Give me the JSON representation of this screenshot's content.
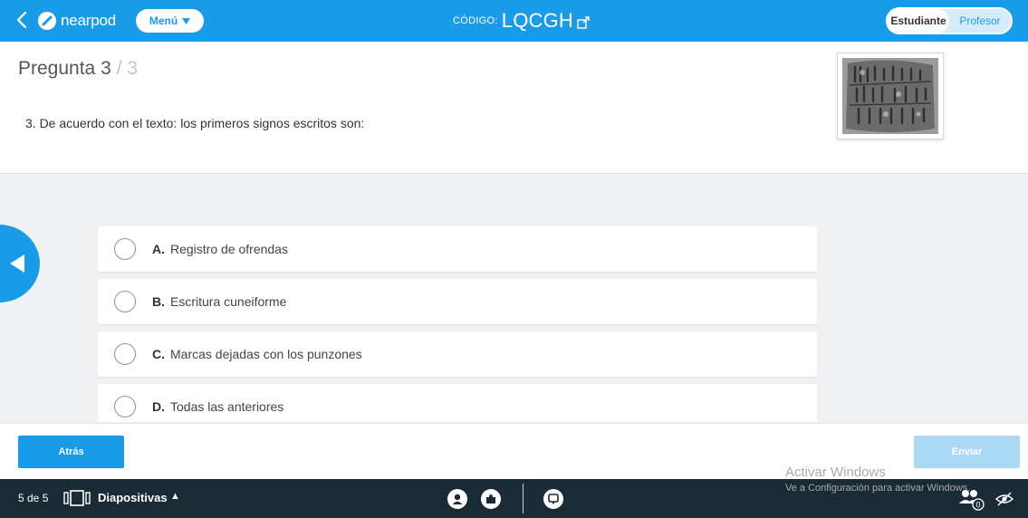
{
  "topbar": {
    "brand": "nearpod",
    "menu_label": "Menú",
    "code_label": "CÓDIGO:",
    "code_value": "LQCGH",
    "role_student": "Estudiante",
    "role_teacher": "Profesor",
    "color": "#1a9be7"
  },
  "question": {
    "label": "Pregunta",
    "number": "3",
    "total": "/ 3",
    "text": "3.  De acuerdo con el texto: los primeros signos escritos son:"
  },
  "options": [
    {
      "letter": "A.",
      "text": "Registro de ofrendas"
    },
    {
      "letter": "B.",
      "text": "Escritura cuneiforme"
    },
    {
      "letter": "C.",
      "text": "Marcas dejadas con los punzones"
    },
    {
      "letter": "D.",
      "text": "Todas las anteriores"
    }
  ],
  "actions": {
    "back_label": "Atrás",
    "send_label": "Enviar"
  },
  "watermark": {
    "title": "Activar Windows",
    "subtitle": "Ve a Configuración para activar Windows."
  },
  "bottombar": {
    "slide_count": "5 de 5",
    "slides_label": "Diapositivas",
    "caret": "▲",
    "participants": "0"
  },
  "icons": {
    "back": "chevron-left-icon",
    "logo": "nearpod-logo-icon",
    "menu_caret": "caret-down-icon",
    "code_share": "external-link-icon",
    "prev_slide": "triangle-left-icon",
    "slides": "slides-icon",
    "bottom_1": "avatar-icon",
    "bottom_2": "puzzle-icon",
    "bottom_3": "chat-icon",
    "participants": "people-icon",
    "visibility": "eye-off-icon"
  }
}
